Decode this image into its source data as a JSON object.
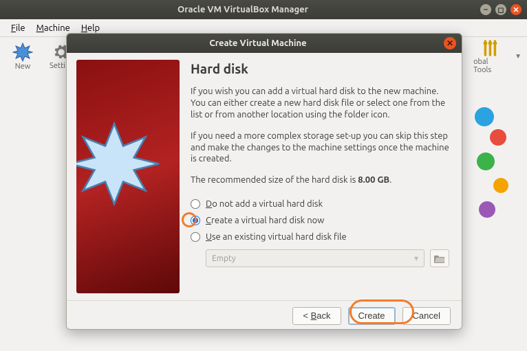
{
  "main_window": {
    "title": "Oracle VM VirtualBox Manager"
  },
  "menubar": {
    "file": "File",
    "machine": "Machine",
    "help": "Help"
  },
  "toolbar": {
    "new": "New",
    "settings": "Settings",
    "global_tools": "Global Tools"
  },
  "dialog": {
    "title": "Create Virtual Machine",
    "heading": "Hard disk",
    "para1": "If you wish you can add a virtual hard disk to the new machine. You can either create a new hard disk file or select one from the list or from another location using the folder icon.",
    "para2": "If you need a more complex storage set-up you can skip this step and make the changes to the machine settings once the machine is created.",
    "recommended_prefix": "The recommended size of the hard disk is ",
    "recommended_size": "8.00 GB",
    "recommended_suffix": ".",
    "radios": {
      "none": "Do not add a virtual hard disk",
      "create": "Create a virtual hard disk now",
      "existing": "Use an existing virtual hard disk file"
    },
    "selected_radio": "create",
    "combo_placeholder": "Empty",
    "buttons": {
      "back": "< Back",
      "create": "Create",
      "cancel": "Cancel"
    }
  }
}
